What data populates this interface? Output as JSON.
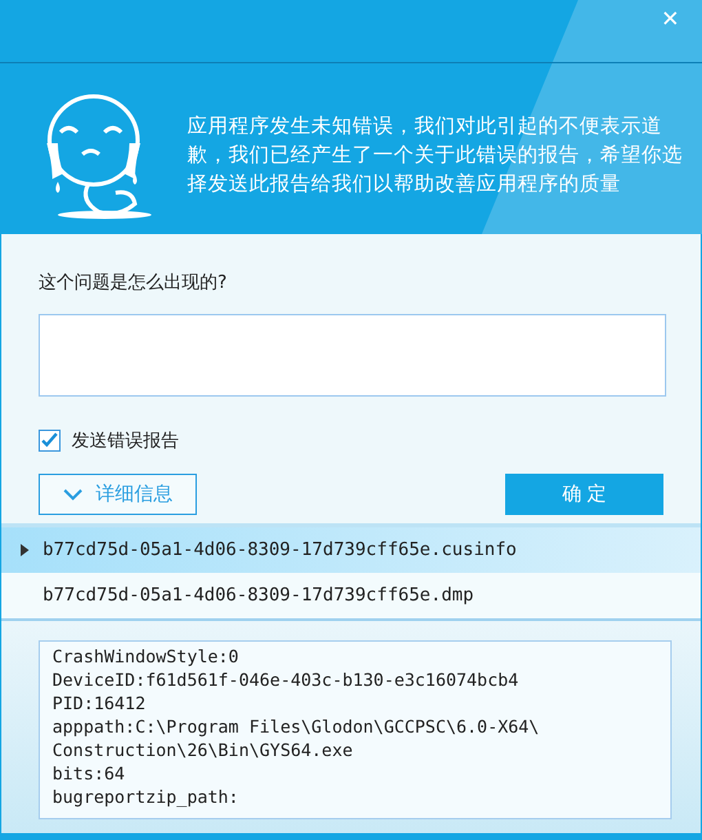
{
  "window": {
    "close": "✕"
  },
  "header": {
    "message": "应用程序发生未知错误，我们对此引起的不便表示道歉，我们已经产生了一个关于此错误的报告，希望你选择发送此报告给我们以帮助改善应用程序的质量"
  },
  "form": {
    "question": "这个问题是怎么出现的?",
    "send_report": {
      "label": "发送错误报告",
      "checked": true
    },
    "details_button": {
      "label": "详细信息",
      "expanded": false
    },
    "confirm_button": "确 定"
  },
  "files": [
    {
      "name": "b77cd75d-05a1-4d06-8309-17d739cff65e.cusinfo",
      "selected": true
    },
    {
      "name": "b77cd75d-05a1-4d06-8309-17d739cff65e.dmp",
      "selected": false
    }
  ],
  "log_lines": [
    "CrashWindowStyle:0",
    "DeviceID:f61d561f-046e-403c-b130-e3c16074bcb4",
    "PID:16412",
    "apppath:C:\\Program Files\\Glodon\\GCCPSC\\6.0-X64\\",
    "Construction\\26\\Bin\\GYS64.exe",
    "bits:64",
    "bugreportzip_path:"
  ]
}
